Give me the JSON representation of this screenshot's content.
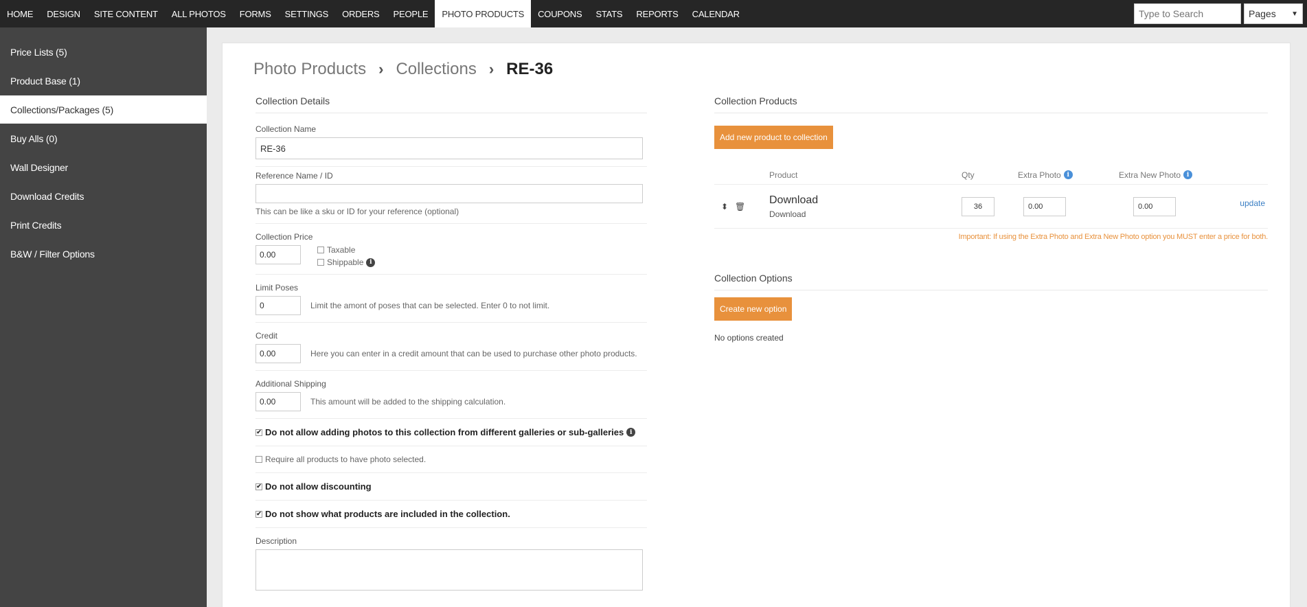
{
  "topnav": {
    "items": [
      "HOME",
      "DESIGN",
      "SITE CONTENT",
      "ALL PHOTOS",
      "FORMS",
      "SETTINGS",
      "ORDERS",
      "PEOPLE",
      "PHOTO PRODUCTS",
      "COUPONS",
      "STATS",
      "REPORTS",
      "CALENDAR"
    ],
    "active": "PHOTO PRODUCTS",
    "search_placeholder": "Type to Search",
    "select_value": "Pages"
  },
  "sidebar": {
    "items": [
      "Price Lists (5)",
      "Product Base (1)",
      "Collections/Packages (5)",
      "Buy Alls (0)",
      "Wall Designer",
      "Download Credits",
      "Print Credits",
      "B&W / Filter Options"
    ],
    "active": "Collections/Packages (5)"
  },
  "breadcrumb": {
    "root": "Photo Products",
    "middle": "Collections",
    "current": "RE-36"
  },
  "details": {
    "title": "Collection Details",
    "name_label": "Collection Name",
    "name_value": "RE-36",
    "ref_label": "Reference Name / ID",
    "ref_value": "",
    "ref_help": "This can be like a sku or ID for your reference (optional)",
    "price_label": "Collection Price",
    "price_value": "0.00",
    "taxable_label": "Taxable",
    "shippable_label": "Shippable",
    "poses_label": "Limit Poses",
    "poses_value": "0",
    "poses_help": "Limit the amont of poses that can be selected. Enter 0 to not limit.",
    "credit_label": "Credit",
    "credit_value": "0.00",
    "credit_help": "Here you can enter in a credit amount that can be used to purchase other photo products.",
    "shipping_label": "Additional Shipping",
    "shipping_value": "0.00",
    "shipping_help": "This amount will be added to the shipping calculation.",
    "opt_galleries": "Do not allow adding photos to this collection from different galleries or sub-galleries",
    "opt_require": "Require all products to have photo selected.",
    "opt_discount": "Do not allow discounting",
    "opt_show": "Do not show what products are included in the collection.",
    "description_label": "Description"
  },
  "products": {
    "title": "Collection Products",
    "add_button": "Add new product to collection",
    "headers": {
      "product": "Product",
      "qty": "Qty",
      "extra_photo": "Extra Photo",
      "extra_new_photo": "Extra New Photo"
    },
    "rows": [
      {
        "name": "Download",
        "sub": "Download",
        "qty": "36",
        "extra_photo": "0.00",
        "extra_new_photo": "0.00",
        "action": "update"
      }
    ],
    "important": "Important: If using the Extra Photo and Extra New Photo option you MUST enter a price for both."
  },
  "options": {
    "title": "Collection Options",
    "create_button": "Create new option",
    "empty_text": "No options created"
  }
}
